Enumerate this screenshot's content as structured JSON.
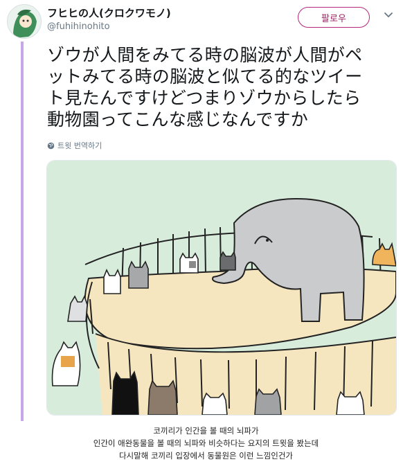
{
  "user": {
    "display_name": "フヒヒの人(クロクワモノ)",
    "handle": "@fuhihinohito"
  },
  "follow_button": {
    "label": "팔로우"
  },
  "tweet": {
    "text_lines": [
      "ゾウが人間をみてる時の脳波が人間がペ",
      "ットみてる時の脳波と似てる的なツイー",
      "ト見たんですけどつまりゾウからしたら",
      "動物園ってこんな感じなんですか"
    ],
    "translate_label": "트윗 번역하기"
  },
  "icons": {
    "avatar": "avatar-icon",
    "chevron": "chevron-down-icon",
    "globe": "globe-icon"
  },
  "colors": {
    "accent": "#9b1f66",
    "thread": "#c9a6ea",
    "image_bg": "#d8ecdc",
    "floor": "#f6e6bf"
  },
  "caption": {
    "lines": [
      "코끼리가 인간을 볼 때의 뇌파가",
      "인간이 애완동물을 볼 때의 뇌파와 비슷하다는 요지의 트윗을 봤는데",
      "다시말해 코끼리 입장에서 동물원은 이런 느낌인건가"
    ]
  }
}
